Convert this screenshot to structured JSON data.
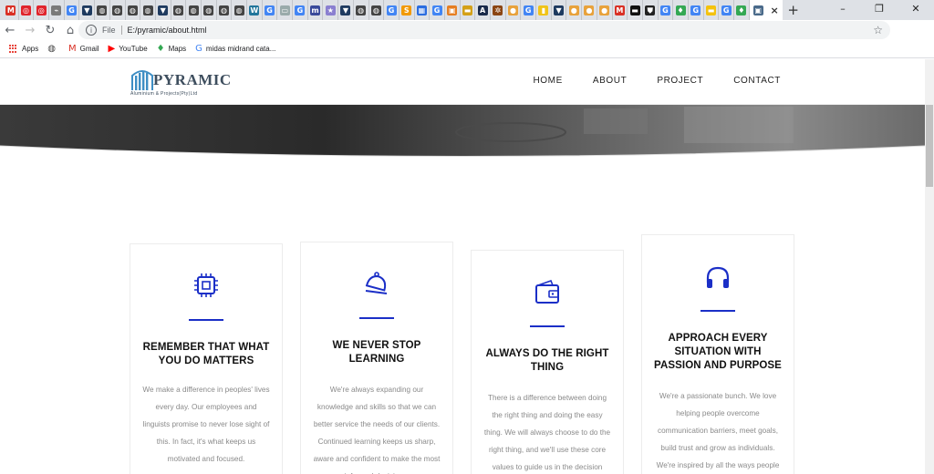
{
  "browser": {
    "url": "E:/pyramic/about.html",
    "url_scheme_label": "File",
    "new_tab_symbol": "+",
    "tab_close_symbol": "×",
    "bookmarks": [
      {
        "label": "Apps",
        "icon": "apps-grid-icon"
      },
      {
        "label": "",
        "icon": "globe-icon"
      },
      {
        "label": "Gmail",
        "icon": "gmail-icon"
      },
      {
        "label": "YouTube",
        "icon": "youtube-icon"
      },
      {
        "label": "Maps",
        "icon": "maps-pin-icon"
      },
      {
        "label": "midas midrand cata...",
        "icon": "google-icon"
      }
    ]
  },
  "site": {
    "logo_word": "PYRAMIC",
    "logo_sub": "Aluminium & Projects(Pty)Ltd",
    "nav": [
      "HOME",
      "ABOUT",
      "PROJECT",
      "CONTACT"
    ]
  },
  "cards": [
    {
      "icon": "chip-icon",
      "title": "REMEMBER THAT WHAT YOU DO MATTERS",
      "text": "We make a difference in peoples' lives every day. Our employees and linguists promise to never lose sight of this. In fact, it's what keeps us motivated and focused."
    },
    {
      "icon": "bell-icon",
      "title": "WE NEVER STOP LEARNING",
      "text": "We're always expanding our knowledge and skills so that we can better service the needs of our clients. Continued learning keeps us sharp, aware and confident to make the most informed decisions."
    },
    {
      "icon": "wallet-icon",
      "title": "ALWAYS DO THE RIGHT THING",
      "text": "There is a difference between doing the right thing and doing the easy thing. We will always choose to do the right thing, and we'll use these core values to guide us in the decision making process."
    },
    {
      "icon": "headphones-icon",
      "title": "APPROACH EVERY SITUATION WITH PASSION AND PURPOSE",
      "text": "We're a passionate bunch. We love helping people overcome communication barriers, meet goals, build trust and grow as individuals. We're inspired by all the ways people benefit from language services."
    }
  ],
  "colors": {
    "accent": "#1b2fc7",
    "tabstrip": "#dee1e6"
  }
}
